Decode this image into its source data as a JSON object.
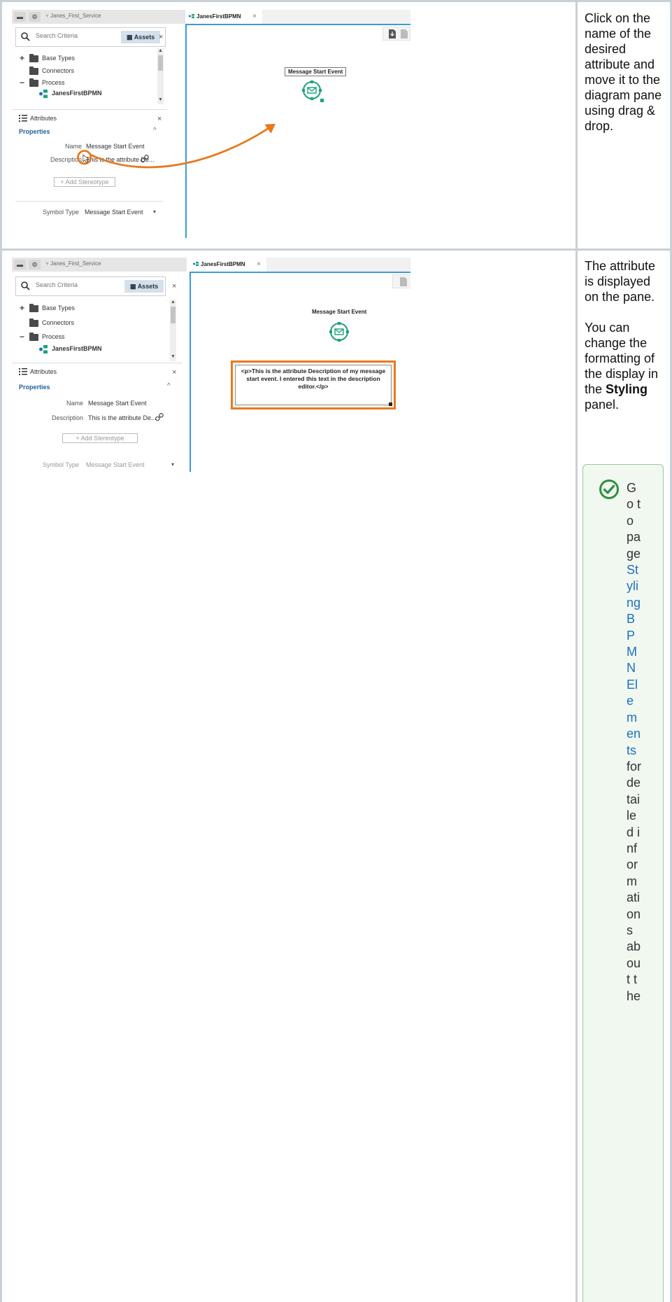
{
  "step1": {
    "instruction": "Click on the name of the desired attribute and move it to the diagram pane using drag & drop.",
    "app": {
      "breadcrumb": "Janes_First_Service",
      "tab_label": "JanesFirstBPMN",
      "tab_close": "×",
      "search_placeholder": "Search Criteria",
      "assets_label": "Assets",
      "close": "×",
      "tree": [
        {
          "toggle": "+",
          "label": "Base Types"
        },
        {
          "toggle": "",
          "label": "Connectors"
        },
        {
          "toggle": "−",
          "label": "Process"
        },
        {
          "toggle": "",
          "label": "JanesFirstBPMN"
        }
      ],
      "attributes_title": "Attributes",
      "properties_title": "Properties",
      "chevron": "^",
      "name_label": "Name",
      "name_value": "Message Start Event",
      "description_label": "Description",
      "description_value": "This is the attribute De...",
      "add_stereotype": "+ Add Stereotype",
      "symbol_type_label": "Symbol Type",
      "symbol_type_value": "Message Start Event",
      "caret": "▾",
      "event_label": "Message Start Event"
    }
  },
  "step2": {
    "instruction_p1": "The attribute is displayed on the pane.",
    "instruction_p2_pre": "You can change the formatting of the display in the ",
    "instruction_p2_bold": "Styling",
    "instruction_p2_post": " panel.",
    "app": {
      "breadcrumb": "Janes_First_Service",
      "tab_label": "JanesFirstBPMN",
      "tab_close": "×",
      "search_placeholder": "Search Criteria",
      "assets_label": "Assets",
      "close": "×",
      "tree": [
        {
          "toggle": "+",
          "label": "Base Types"
        },
        {
          "toggle": "",
          "label": "Connectors"
        },
        {
          "toggle": "−",
          "label": "Process"
        },
        {
          "toggle": "",
          "label": "JanesFirstBPMN"
        }
      ],
      "attributes_title": "Attributes",
      "properties_title": "Properties",
      "chevron": "^",
      "name_label": "Name",
      "name_value": "Message Start Event",
      "description_label": "Description",
      "description_value": "This is the attribute De...",
      "add_stereotype": "+ Add Stereotype",
      "symbol_type_label": "Symbol Type",
      "symbol_type_value": "Message Start Event",
      "caret": "▾",
      "event_label": "Message Start Event",
      "description_box_text": "<p>This is the attribute Description of my message start event. I entered this text in the description editor.</p>"
    },
    "note": {
      "pre": "Go to page ",
      "link": "Styling BPMN Elements",
      "post": " for detailed informations about the"
    }
  },
  "colors": {
    "accent_orange": "#e8791d",
    "canvas_border": "#3b9ad9",
    "event_green": "#1aa37a",
    "note_bg": "#f0f8f0",
    "link_blue": "#1f6fc2"
  }
}
